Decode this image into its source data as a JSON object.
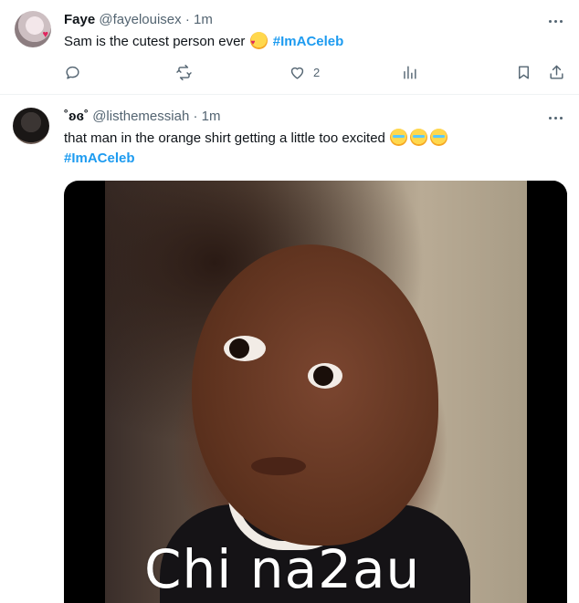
{
  "tweets": [
    {
      "display_name": "Faye",
      "handle": "@fayelouisex",
      "time": "· 1m",
      "text": "Sam is the cutest person ever",
      "emoji": "smiling-face-with-hearts",
      "hashtag": "#ImACeleb",
      "likes": "2"
    },
    {
      "display_name": "˚ʚɞ˚",
      "handle": "@listhemessiah",
      "time": "· 1m",
      "text": "that man in the orange shirt getting a little too excited",
      "emoji": "loudly-crying-face",
      "hashtag": "#ImACeleb"
    }
  ],
  "watermark": "Chi na2au",
  "colors": {
    "accent": "#1d9bf0",
    "text": "#0f1419",
    "secondary": "#536471",
    "divider": "#eff3f4"
  }
}
